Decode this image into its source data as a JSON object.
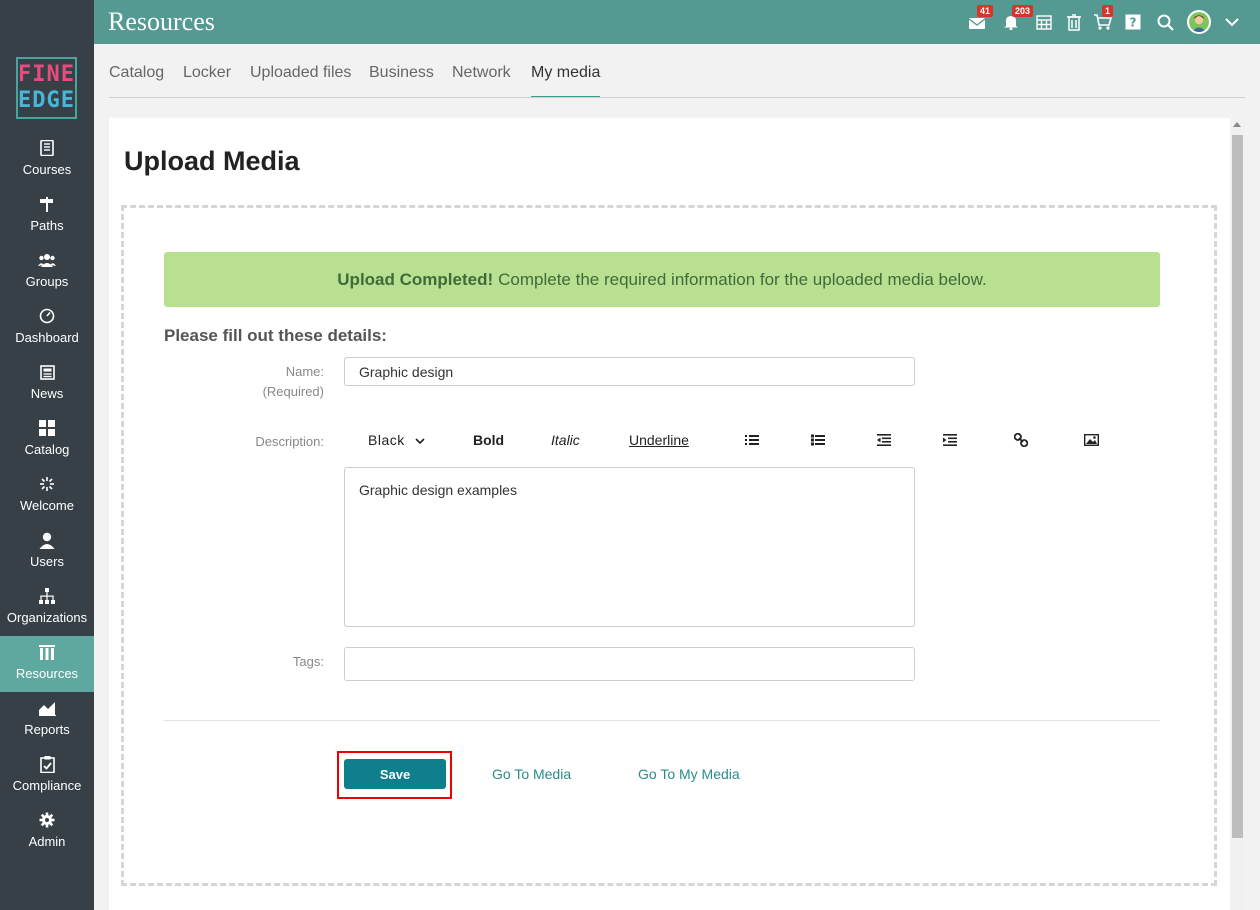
{
  "header": {
    "title": "Resources"
  },
  "topbar": {
    "badges": {
      "messages": "41",
      "notifications": "203",
      "cart": "1"
    },
    "icons": [
      "envelope-icon",
      "bell-icon",
      "calendar-icon",
      "trash-icon",
      "cart-icon",
      "help-icon",
      "search-icon",
      "avatar",
      "chevron-down-icon"
    ]
  },
  "logo": {
    "line1": "FINE",
    "line2": "EDGE"
  },
  "sidebar": {
    "items": [
      {
        "label": "Courses",
        "icon": "book-icon"
      },
      {
        "label": "Paths",
        "icon": "signpost-icon"
      },
      {
        "label": "Groups",
        "icon": "people-icon"
      },
      {
        "label": "Dashboard",
        "icon": "gauge-icon"
      },
      {
        "label": "News",
        "icon": "newspaper-icon"
      },
      {
        "label": "Catalog",
        "icon": "grid-icon"
      },
      {
        "label": "Welcome",
        "icon": "sparkle-icon"
      },
      {
        "label": "Users",
        "icon": "user-icon"
      },
      {
        "label": "Organizations",
        "icon": "org-chart-icon"
      },
      {
        "label": "Resources",
        "icon": "library-icon",
        "active": true
      },
      {
        "label": "Reports",
        "icon": "chart-icon"
      },
      {
        "label": "Compliance",
        "icon": "clipboard-check-icon"
      },
      {
        "label": "Admin",
        "icon": "gear-icon"
      }
    ]
  },
  "tabs": [
    {
      "label": "Catalog"
    },
    {
      "label": "Locker"
    },
    {
      "label": "Uploaded files"
    },
    {
      "label": "Business"
    },
    {
      "label": "Network"
    },
    {
      "label": "My media",
      "active": true
    }
  ],
  "page": {
    "title": "Upload Media",
    "alert": {
      "strong": "Upload Completed!",
      "text": "Complete the required information for the uploaded media below."
    },
    "form_heading": "Please fill out these details:",
    "name": {
      "label": "Name:",
      "sublabel": "(Required)",
      "value": "Graphic design"
    },
    "description": {
      "label": "Description:",
      "value": "Graphic design examples",
      "toolbar": {
        "color": "Black",
        "bold": "Bold",
        "italic": "Italic",
        "underline": "Underline"
      }
    },
    "tags": {
      "label": "Tags:",
      "value": ""
    },
    "actions": {
      "save": "Save",
      "go_to_media": "Go To Media",
      "go_to_my_media": "Go To My Media"
    }
  },
  "colors": {
    "topbar": "#559a92",
    "sidebar": "#374046",
    "sidebar_active": "#5fa8a0",
    "alert_bg": "#b9e091",
    "save_button": "#0f7f8e",
    "badge": "#d9342b",
    "highlight": "#e00000"
  }
}
